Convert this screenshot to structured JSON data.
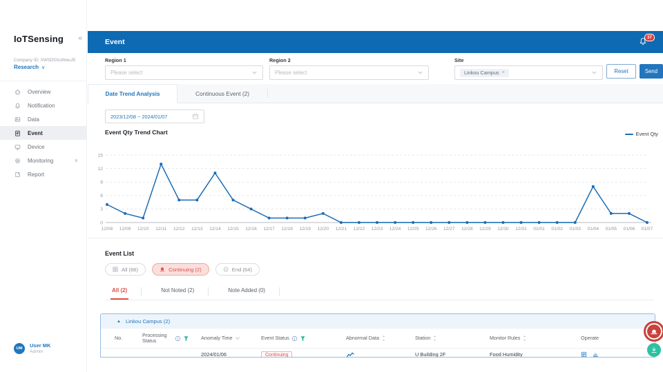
{
  "sidebar": {
    "logo": "IoTSensing",
    "collapse_icon": "«",
    "company_id": "Company ID: XWSD5XuWwuJ5",
    "org": "Research",
    "items": [
      {
        "label": "Overview",
        "icon": "home"
      },
      {
        "label": "Notification",
        "icon": "bell"
      },
      {
        "label": "Data",
        "icon": "image"
      },
      {
        "label": "Event",
        "icon": "document",
        "active": true
      },
      {
        "label": "Device",
        "icon": "monitor"
      },
      {
        "label": "Monitoring",
        "icon": "gear",
        "expandable": true
      },
      {
        "label": "Report",
        "icon": "report"
      }
    ],
    "user": {
      "initials": "UM",
      "name": "User MK",
      "role": "Admin"
    }
  },
  "header": {
    "title": "Event",
    "notification_count": "37"
  },
  "filters": {
    "region1": {
      "label": "Region 1",
      "placeholder": "Please select"
    },
    "region2": {
      "label": "Region 2",
      "placeholder": "Please select"
    },
    "site": {
      "label": "Site",
      "chip": "Linkou Campus",
      "chip_close": "×"
    },
    "reset_label": "Reset",
    "send_label": "Send"
  },
  "main_tabs": [
    {
      "label": "Date Trend Analysis",
      "active": true
    },
    {
      "label": "Continuous Event (2)",
      "active": false
    }
  ],
  "trend": {
    "date_range": "2023/12/08 ~ 2024/01/07",
    "section_title": "Event Qty Trend Chart",
    "legend": "Event Qty"
  },
  "chart_data": {
    "type": "line",
    "title": "Event Qty Trend Chart",
    "categories": [
      "12/08",
      "12/09",
      "12/10",
      "12/11",
      "12/12",
      "12/13",
      "12/14",
      "12/15",
      "12/16",
      "12/17",
      "12/18",
      "12/19",
      "12/20",
      "12/21",
      "12/22",
      "12/23",
      "12/24",
      "12/25",
      "12/26",
      "12/27",
      "12/28",
      "12/29",
      "12/30",
      "12/31",
      "01/01",
      "01/02",
      "01/03",
      "01/04",
      "01/05",
      "01/06",
      "01/07"
    ],
    "series": [
      {
        "name": "Event Qty",
        "color": "#1a6cb5",
        "values": [
          4,
          2,
          1,
          13,
          5,
          5,
          11,
          5,
          3,
          1,
          1,
          1,
          2,
          0,
          0,
          0,
          0,
          0,
          0,
          0,
          0,
          0,
          0,
          0,
          0,
          0,
          0,
          8,
          2,
          2,
          0
        ]
      }
    ],
    "xlabel": "",
    "ylabel": "",
    "ylim": [
      0,
      15
    ],
    "yticks": [
      0,
      3,
      6,
      9,
      12,
      15
    ],
    "grid": "dashed-horizontal",
    "legend_position": "top-right"
  },
  "event_list": {
    "title": "Event List",
    "status_chips": [
      {
        "label": "All (66)",
        "icon": "grid",
        "active": false
      },
      {
        "label": "Continuing (2)",
        "icon": "alarm",
        "active": true
      },
      {
        "label": "End (64)",
        "icon": "end",
        "active": false
      }
    ],
    "note_tabs": [
      {
        "label": "All (2)",
        "active": true
      },
      {
        "label": "Not Noted (2)",
        "active": false
      },
      {
        "label": "Note Added (0)",
        "active": false
      }
    ],
    "group_label": "Linkou Campus (2)",
    "columns": [
      {
        "label": "No.",
        "icons": []
      },
      {
        "label": "Processing Status",
        "icons": [
          "info",
          "funnel"
        ]
      },
      {
        "label": "Anomaly Time",
        "icons": [
          "caret"
        ]
      },
      {
        "label": "Event Status",
        "icons": [
          "info",
          "funnel"
        ]
      },
      {
        "label": "Abnormal Data",
        "icons": [
          "sort"
        ]
      },
      {
        "label": "Station",
        "icons": [
          "sort"
        ]
      },
      {
        "label": "Monitor Rules",
        "icons": [
          "sort"
        ]
      },
      {
        "label": "Operate",
        "icons": []
      }
    ],
    "rows": [
      {
        "anomaly_time": "2024/01/06",
        "event_status": "Continuing",
        "station": "U Building 2F",
        "monitor_rules": "Food Humidity"
      }
    ]
  }
}
